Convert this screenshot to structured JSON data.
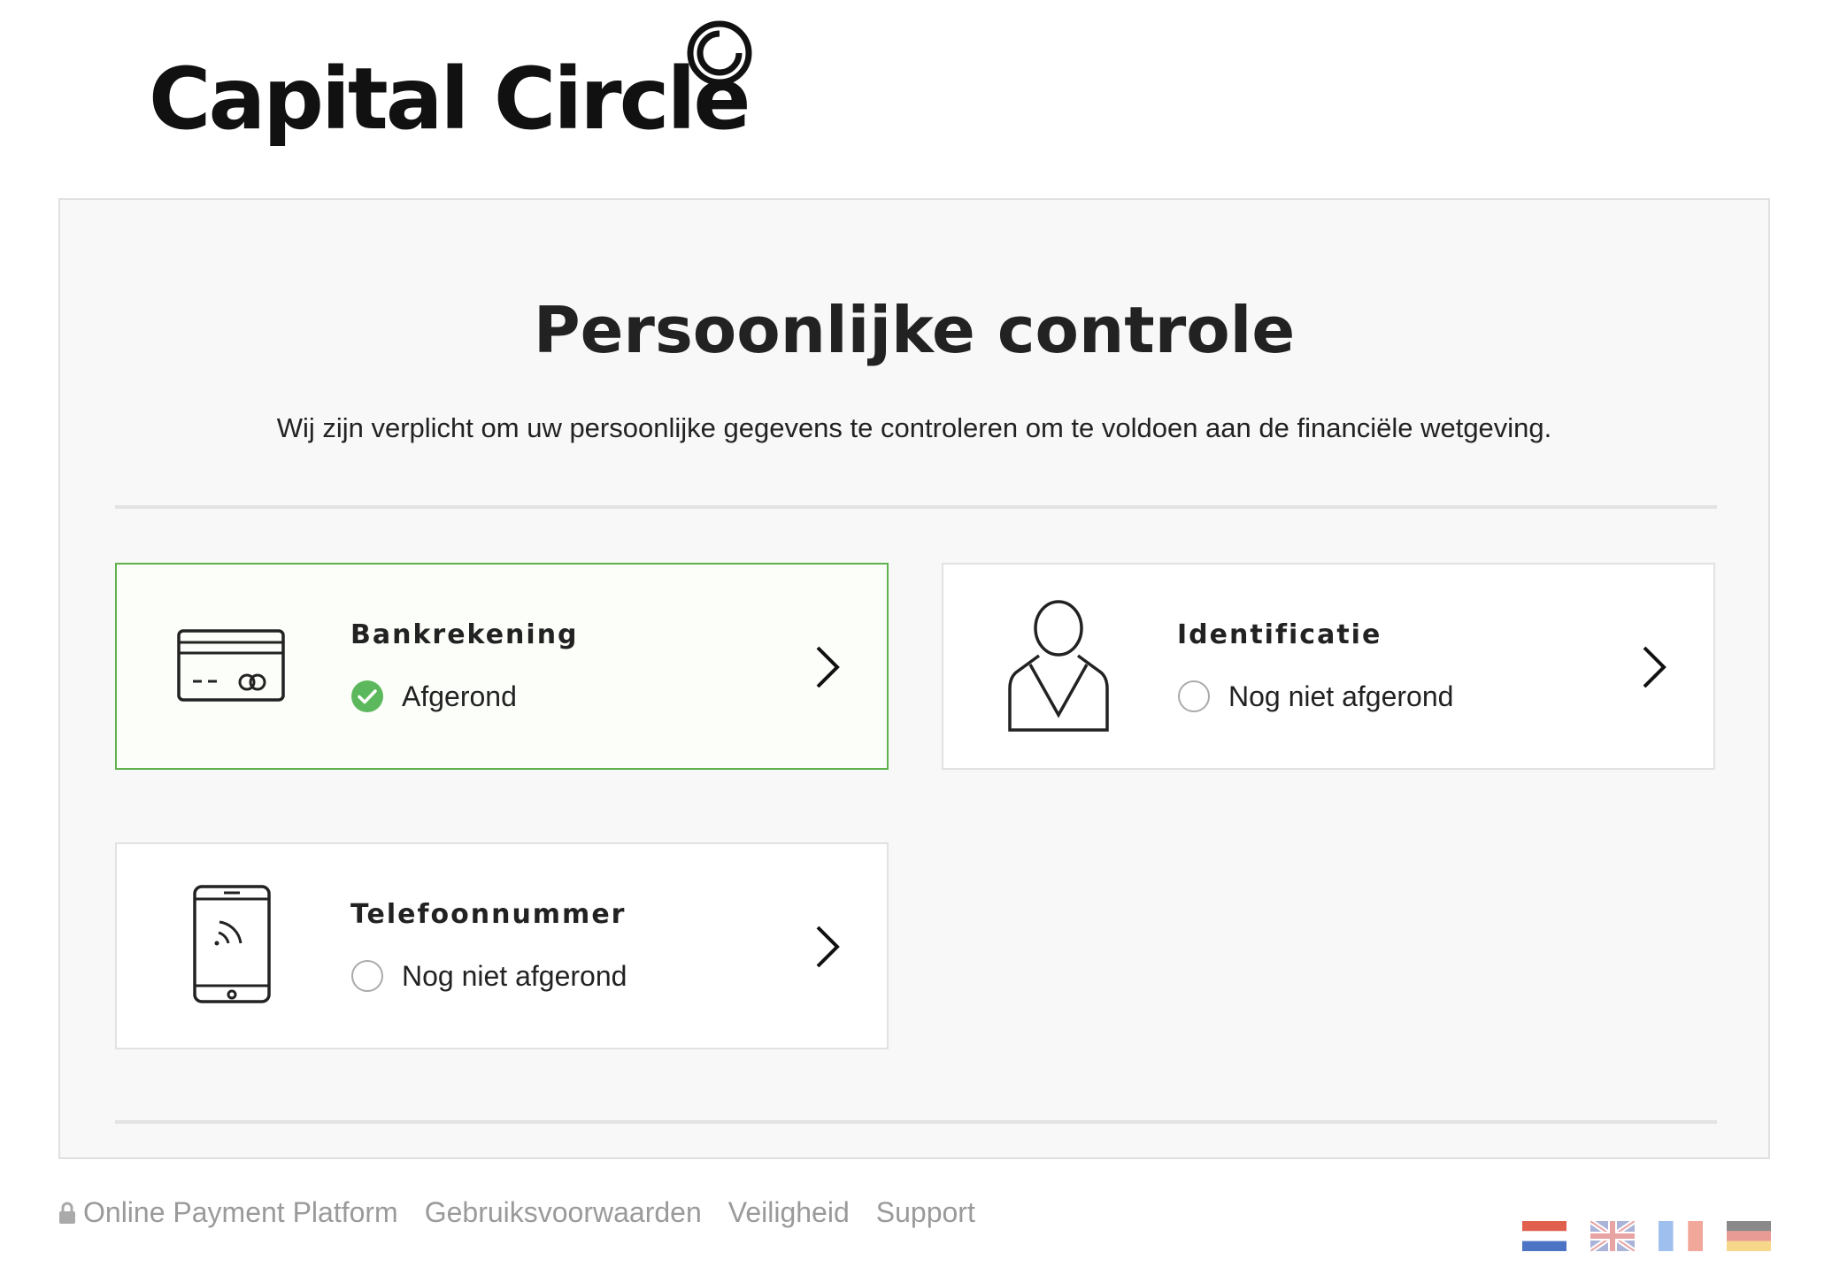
{
  "brand": {
    "name": "Capital Circle",
    "logo_icon": "concentric-circle-logo-icon"
  },
  "page": {
    "title": "Persoonlijke controle",
    "subtitle": "Wij zijn verplicht om uw persoonlijke gegevens te controleren om te voldoen aan de financiële wetgeving."
  },
  "cards": [
    {
      "title": "Bankrekening",
      "status": "Afgerond",
      "completed": true,
      "icon": "credit-card-icon"
    },
    {
      "title": "Identificatie",
      "status": "Nog niet afgerond",
      "completed": false,
      "icon": "person-icon"
    },
    {
      "title": "Telefoonnummer",
      "status": "Nog niet afgerond",
      "completed": false,
      "icon": "smartphone-icon"
    }
  ],
  "footer": {
    "links": [
      {
        "label": "Online Payment Platform",
        "icon": "lock-icon"
      },
      {
        "label": "Gebruiksvoorwaarden"
      },
      {
        "label": "Veiligheid"
      },
      {
        "label": "Support"
      }
    ]
  },
  "languages": [
    "nl-flag-icon",
    "en-flag-icon",
    "fr-flag-icon",
    "de-flag-icon"
  ],
  "colors": {
    "accent_green": "#5fb24e",
    "check_green": "#5cb85c",
    "panel_background": "#f8f8f8",
    "footer_text": "#9a9a9a"
  }
}
